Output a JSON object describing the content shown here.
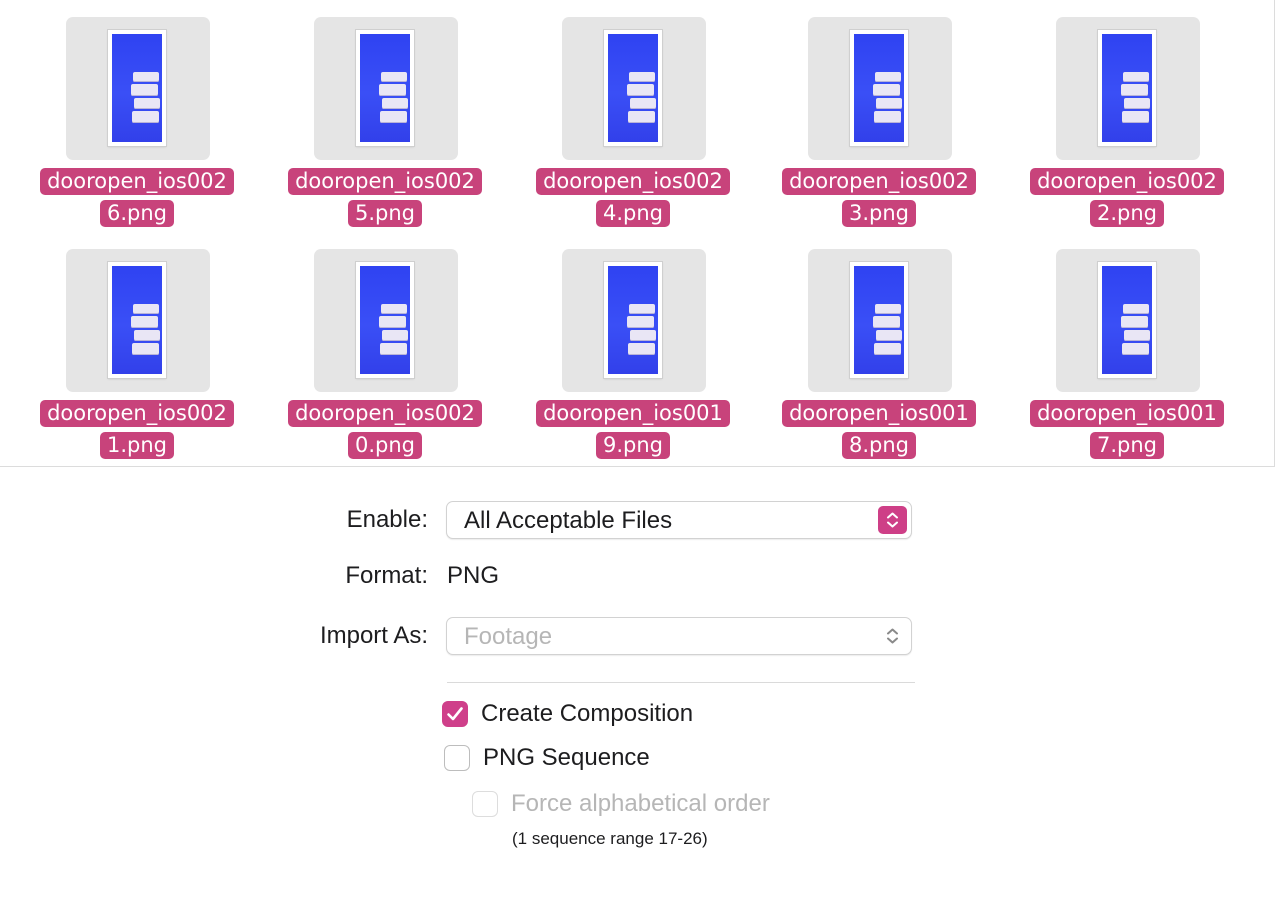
{
  "files": [
    {
      "name_line1": "dooropen_ios002",
      "name_line2": "6.png"
    },
    {
      "name_line1": "dooropen_ios002",
      "name_line2": "5.png"
    },
    {
      "name_line1": "dooropen_ios002",
      "name_line2": "4.png"
    },
    {
      "name_line1": "dooropen_ios002",
      "name_line2": "3.png"
    },
    {
      "name_line1": "dooropen_ios002",
      "name_line2": "2.png"
    },
    {
      "name_line1": "dooropen_ios002",
      "name_line2": "1.png"
    },
    {
      "name_line1": "dooropen_ios002",
      "name_line2": "0.png"
    },
    {
      "name_line1": "dooropen_ios001",
      "name_line2": "9.png"
    },
    {
      "name_line1": "dooropen_ios001",
      "name_line2": "8.png"
    },
    {
      "name_line1": "dooropen_ios001",
      "name_line2": "7.png"
    }
  ],
  "options": {
    "enable_label": "Enable:",
    "enable_value": "All Acceptable Files",
    "format_label": "Format:",
    "format_value": "PNG",
    "import_as_label": "Import As:",
    "import_as_value": "Footage",
    "create_composition_label": "Create Composition",
    "create_composition_checked": true,
    "png_sequence_label": "PNG Sequence",
    "png_sequence_checked": false,
    "force_alpha_label": "Force alphabetical order",
    "force_alpha_checked": false,
    "sequence_note": "(1 sequence range 17-26)"
  },
  "colors": {
    "selection": "#c8437b",
    "accent": "#cf3f8a",
    "thumb_blue": "#3a4ff6"
  },
  "icons": {
    "popup_arrows": "chevron-up-down-icon",
    "checkmark": "checkmark-icon"
  }
}
